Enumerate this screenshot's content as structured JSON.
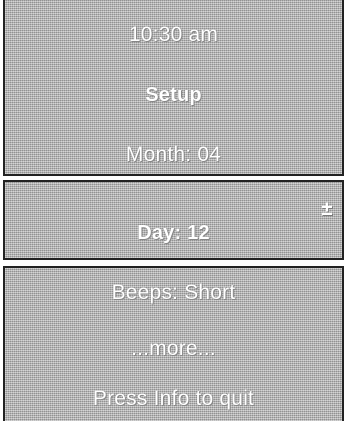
{
  "screen": {
    "time": "10:30 am",
    "title": "Setup",
    "month_item": "Month: 04",
    "selected_item": "Day: 12",
    "adjust_symbol": "±",
    "beeps_item": "Beeps: Short",
    "more_item": "...more...",
    "footer_hint": "Press Info to quit"
  },
  "colors": {
    "panel": "#b4b4b4",
    "text": "#ffffff",
    "border": "#222222"
  }
}
